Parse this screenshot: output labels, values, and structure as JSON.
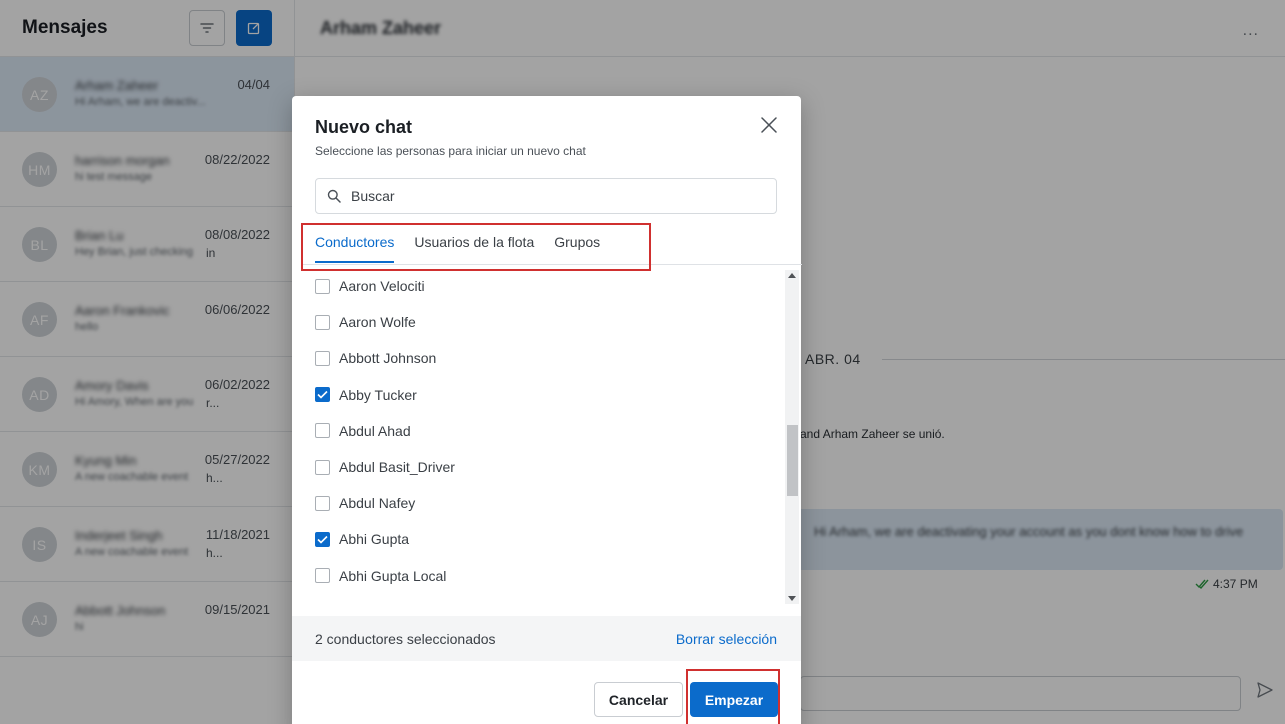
{
  "sidebar": {
    "title": "Mensajes",
    "conversations": [
      {
        "initials": "AZ",
        "name": "Arham Zaheer",
        "preview": "Hi Arham, we are deactiv...",
        "date": "04/04",
        "active": true
      },
      {
        "initials": "HM",
        "name": "harrison morgan",
        "preview": "hi test message",
        "date": "08/22/2022"
      },
      {
        "initials": "BL",
        "name": "Brian Lu",
        "preview": "Hey Brian, just checking",
        "preview_tail": "in",
        "date": "08/08/2022"
      },
      {
        "initials": "AF",
        "name": "Aaron Frankovic",
        "preview": "hello",
        "date": "06/06/2022"
      },
      {
        "initials": "AD",
        "name": "Amory Davis",
        "preview": "Hi Amory, When are you",
        "preview_tail": "r...",
        "date": "06/02/2022"
      },
      {
        "initials": "KM",
        "name": "Kyung Min",
        "preview": "A new coachable event",
        "preview_tail": "h...",
        "date": "05/27/2022"
      },
      {
        "initials": "IS",
        "name": "Inderjeet Singh",
        "preview": "A new coachable event",
        "preview_tail": "h...",
        "date": "11/18/2021"
      },
      {
        "initials": "AJ",
        "name": "Abbott Johnson",
        "preview": "hi",
        "date": "09/15/2021"
      }
    ]
  },
  "main": {
    "title": "Arham Zaheer",
    "more": "...",
    "date_separator": "ABR. 04",
    "system_message": "and Arham Zaheer se unió.",
    "bubble_text": "Hi Arham, we are deactivating your account as you dont know how to drive",
    "message_time": "4:37 PM"
  },
  "modal": {
    "title": "Nuevo chat",
    "subtitle": "Seleccione las personas para iniciar un nuevo chat",
    "search_placeholder": "Buscar",
    "tabs": [
      {
        "label": "Conductores",
        "active": true
      },
      {
        "label": "Usuarios de la flota",
        "active": false
      },
      {
        "label": "Grupos",
        "active": false
      }
    ],
    "drivers": [
      {
        "name": "Aaron Velociti",
        "checked": false
      },
      {
        "name": "Aaron Wolfe",
        "checked": false
      },
      {
        "name": "Abbott Johnson",
        "checked": false
      },
      {
        "name": "Abby Tucker",
        "checked": true
      },
      {
        "name": "Abdul Ahad",
        "checked": false
      },
      {
        "name": "Abdul Basit_Driver",
        "checked": false
      },
      {
        "name": "Abdul Nafey",
        "checked": false
      },
      {
        "name": "Abhi Gupta",
        "checked": true
      },
      {
        "name": "Abhi Gupta Local",
        "checked": false
      }
    ],
    "selection_count": "2 conductores seleccionados",
    "clear_label": "Borrar selección",
    "cancel_label": "Cancelar",
    "start_label": "Empezar"
  },
  "colors": {
    "accent": "#0b6bcb",
    "highlight": "#d0302f",
    "active_conversation": "#dce9f6"
  }
}
